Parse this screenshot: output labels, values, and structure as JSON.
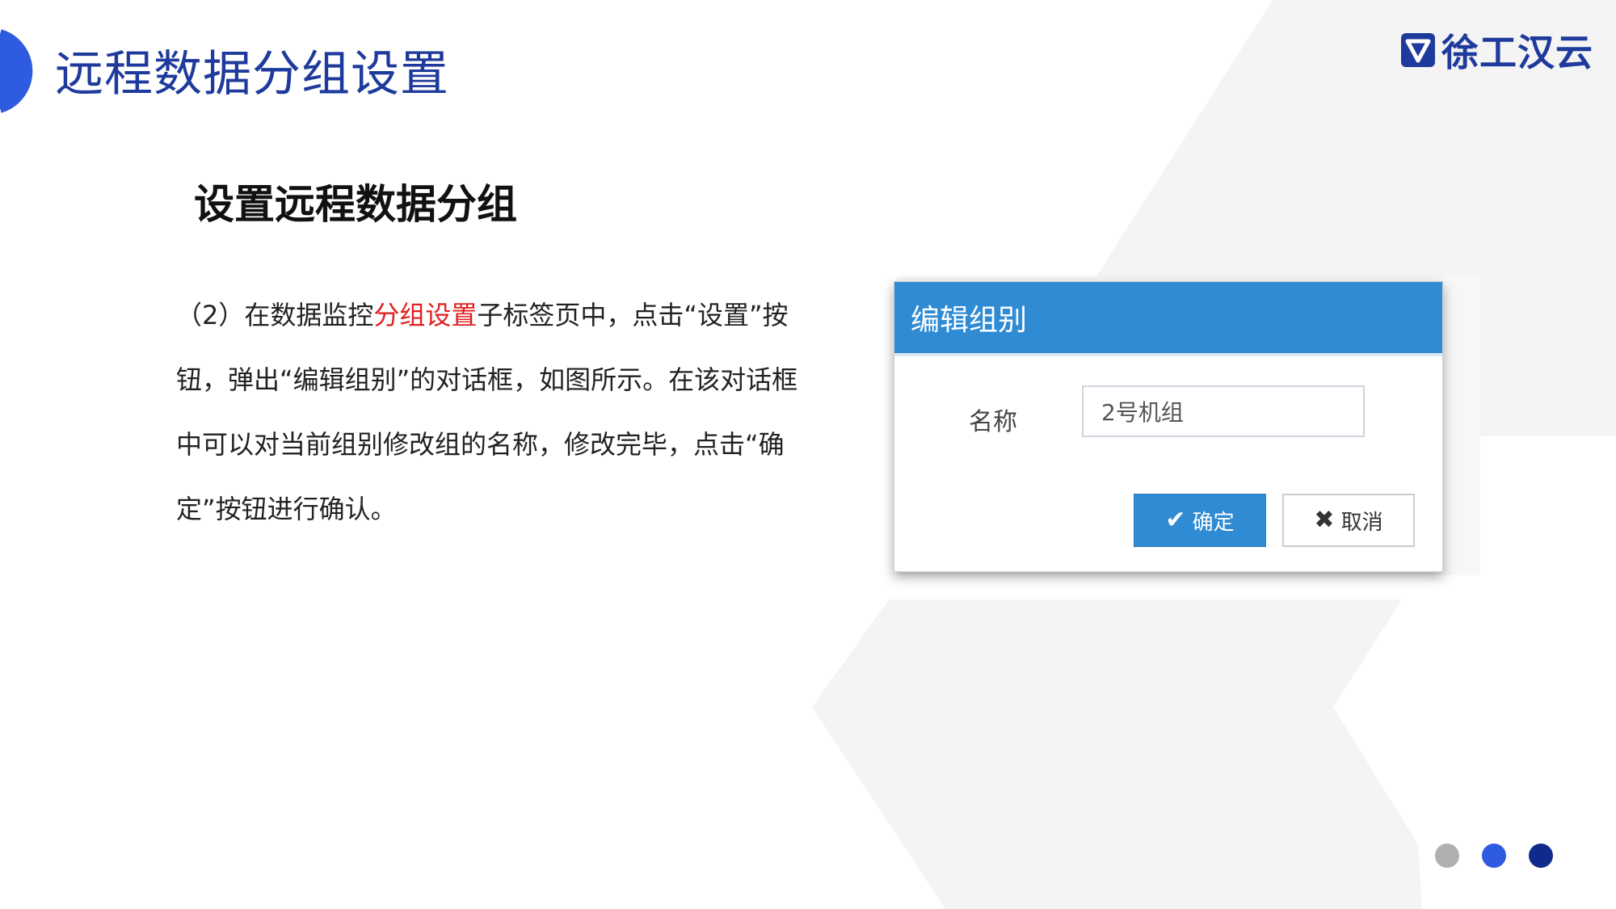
{
  "slide": {
    "title": "远程数据分组设置",
    "brand": "徐工汉云",
    "subtitle": "设置远程数据分组",
    "paragraph": {
      "part1": "（2）在数据监控",
      "highlight": "分组设置",
      "part2": "子标签页中，点击“设置”按钮，弹出“编辑组别”的对话框，如图所示。在该对话框中可以对当前组别修改组的名称，修改完毕，点击“确定”按钮进行确认。"
    }
  },
  "dialog": {
    "title": "编辑组别",
    "name_label": "名称",
    "name_value": "2号机组",
    "ok_label": "确定",
    "ok_icon": "check-icon",
    "cancel_label": "取消",
    "cancel_icon": "close-icon"
  },
  "colors": {
    "title_blue": "#1e3a9c",
    "dialog_header": "#2e8bd4",
    "highlight_red": "#e02020",
    "dot_gray": "#b0b0b0",
    "dot_blue": "#2f5be0",
    "dot_navy": "#0f2a8a"
  }
}
